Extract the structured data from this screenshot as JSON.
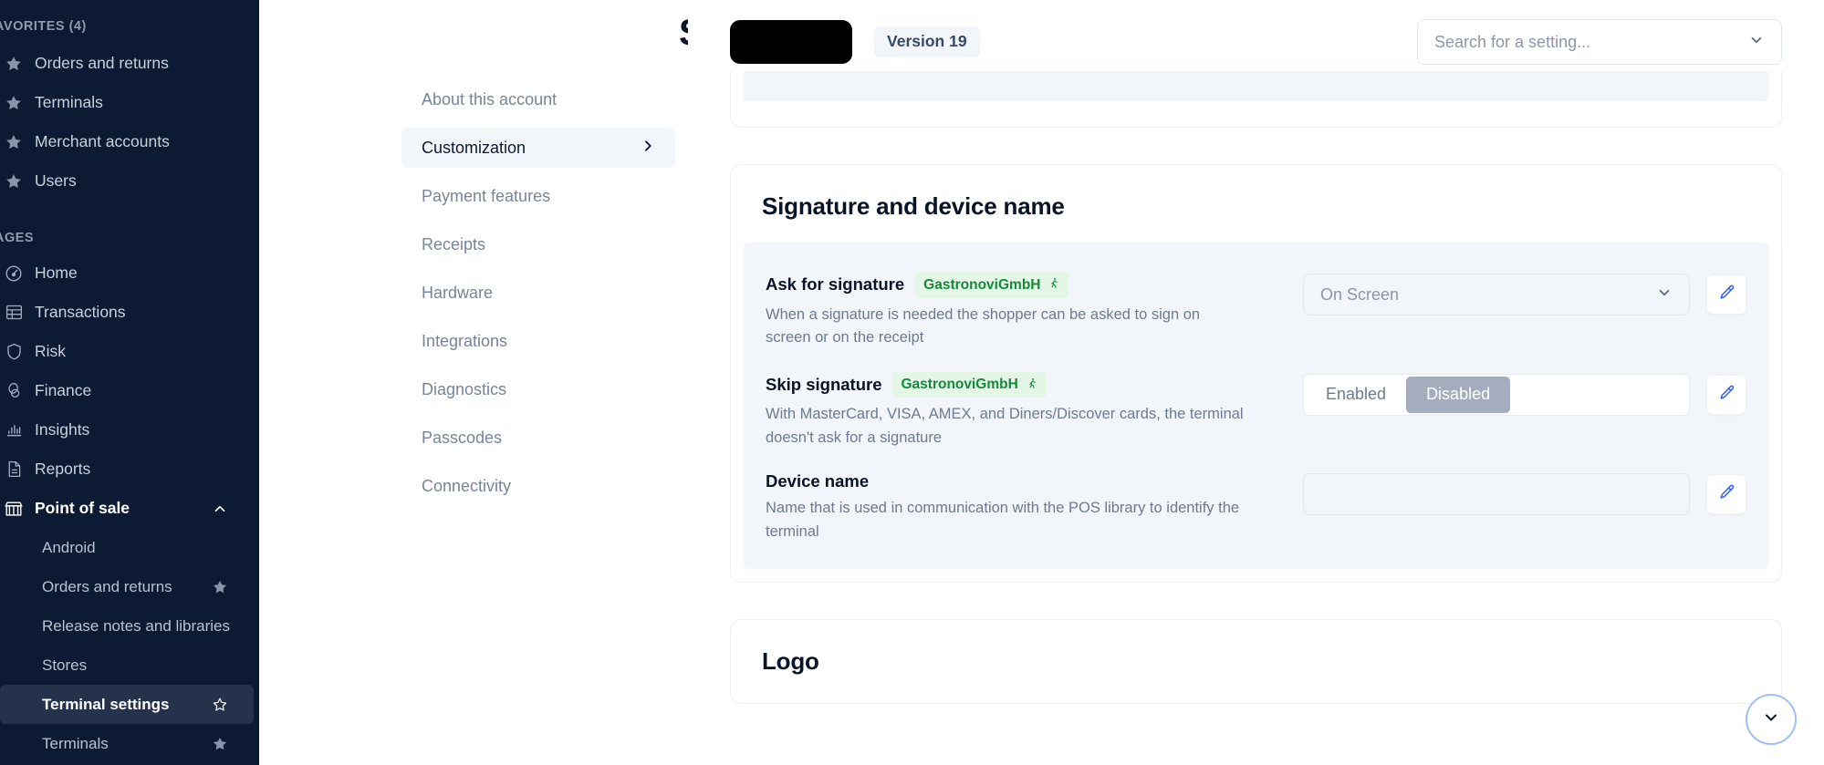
{
  "sidebar": {
    "favorites_label": "AVORITES (4)",
    "pages_label": "AGES",
    "favorites": [
      {
        "label": "Orders and returns",
        "icon": "star-icon"
      },
      {
        "label": "Terminals",
        "icon": "star-icon"
      },
      {
        "label": "Merchant accounts",
        "icon": "star-icon"
      },
      {
        "label": "Users",
        "icon": "star-icon"
      }
    ],
    "pages": [
      {
        "label": "Home",
        "icon": "home-icon"
      },
      {
        "label": "Transactions",
        "icon": "table-icon"
      },
      {
        "label": "Risk",
        "icon": "shield-icon"
      },
      {
        "label": "Finance",
        "icon": "coins-icon"
      },
      {
        "label": "Insights",
        "icon": "bar-chart-icon"
      },
      {
        "label": "Reports",
        "icon": "document-icon"
      },
      {
        "label": "Point of sale",
        "icon": "store-icon"
      }
    ],
    "pos_children": [
      {
        "label": "Android",
        "starred": false,
        "active": false
      },
      {
        "label": "Orders and returns",
        "starred": true,
        "active": false
      },
      {
        "label": "Release notes and libraries",
        "starred": false,
        "active": false
      },
      {
        "label": "Stores",
        "starred": false,
        "active": false
      },
      {
        "label": "Terminal settings",
        "starred": true,
        "active": true
      },
      {
        "label": "Terminals",
        "starred": true,
        "active": false
      }
    ]
  },
  "settings_nav": {
    "title": "Settings",
    "items": [
      {
        "label": "About this account",
        "active": false
      },
      {
        "label": "Customization",
        "active": true
      },
      {
        "label": "Payment features",
        "active": false
      },
      {
        "label": "Receipts",
        "active": false
      },
      {
        "label": "Hardware",
        "active": false
      },
      {
        "label": "Integrations",
        "active": false
      },
      {
        "label": "Diagnostics",
        "active": false
      },
      {
        "label": "Passcodes",
        "active": false
      },
      {
        "label": "Connectivity",
        "active": false
      }
    ]
  },
  "header": {
    "version_badge": "Version 19",
    "search_value": "Search for a setting...",
    "search_placeholder": "Search for a setting..."
  },
  "signature_card": {
    "title": "Signature and device name",
    "rows": [
      {
        "title": "Ask for signature",
        "badge": "GastronoviGmbH",
        "description": "When a signature is needed the shopper can be asked to sign on screen or on the receipt",
        "control": "select",
        "value": "On Screen"
      },
      {
        "title": "Skip signature",
        "badge": "GastronoviGmbH",
        "description": "With MasterCard, VISA, AMEX, and Diners/Discover cards, the terminal doesn't ask for a signature",
        "control": "segmented",
        "options": [
          "Enabled",
          "Disabled"
        ],
        "selected": "Disabled"
      },
      {
        "title": "Device name",
        "badge": "",
        "description": "Name that is used in communication with the POS library to identify the terminal",
        "control": "select",
        "value": ""
      }
    ]
  },
  "logo_card": {
    "title": "Logo"
  },
  "colors": {
    "sidebar_bg": "#0c1b33",
    "sidebar_active": "#24324c",
    "panel_bg": "#f2f5f9",
    "badge_green_bg": "#e4f7e6",
    "badge_green_text": "#17883b",
    "accent_blue": "#2f5bff",
    "segment_on_bg": "#a3adbe"
  }
}
